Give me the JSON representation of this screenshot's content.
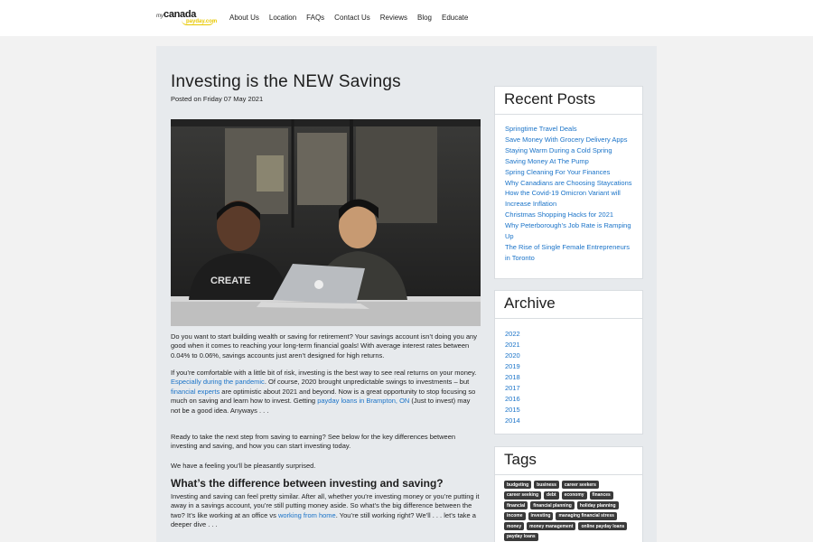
{
  "header": {
    "logo": {
      "my": "my",
      "canada": "canada",
      "payday": "payday.com"
    },
    "nav": [
      "About Us",
      "Location",
      "FAQs",
      "Contact Us",
      "Reviews",
      "Blog",
      "Educate"
    ]
  },
  "article": {
    "title": "Investing is the NEW Savings",
    "posted": "Posted on Friday 07 May 2021",
    "image_text": "CREATE",
    "p1": "Do you want to start building wealth or saving for retirement? Your savings account isn’t doing you any good when it comes to reaching your long-term financial goals! With average interest rates between 0.04% to 0.06%, savings accounts just aren’t designed for high returns.",
    "p2": {
      "t1": "If you’re comfortable with a little bit of risk, investing is the best way to see real returns on your money. ",
      "l1": "Especially during the pandemic",
      "t2": ". Of course, 2020 brought unpredictable swings to investments – but ",
      "l2": "financial experts",
      "t3": " are optimistic about 2021 and beyond. Now is a great opportunity to stop focusing so much on saving and learn how to invest. Getting ",
      "l3": "payday loans in Brampton, ON",
      "t4": " (Just to invest) may not be a good idea. Anyways . . ."
    },
    "p3": "Ready to take the next step from saving to earning? See below for the key differences between investing and saving, and how you can start investing today.",
    "p4": "We have a feeling you’ll be pleasantly surprised.",
    "subhead": "What’s the difference between investing and saving?",
    "p5": {
      "t1": "Investing and saving can feel pretty similar. After all, whether you’re investing money or you’re putting it away in a savings account, you’re still putting money aside. So what’s the big difference between the two? It’s like working at an office vs ",
      "l1": "working from home",
      "t2": ". You’re still working right? We’ll . . . let’s take a deeper dive . . ."
    }
  },
  "sidebar": {
    "recent": {
      "heading": "Recent Posts",
      "items": [
        "Springtime Travel Deals",
        "Save Money With Grocery Delivery Apps",
        "Staying Warm During a Cold Spring",
        "Saving Money At The Pump",
        "Spring Cleaning For Your Finances",
        "Why Canadians are Choosing Staycations",
        "How the Covid-19 Omicron Variant will Increase Inflation",
        "Christmas Shopping Hacks for 2021",
        "Why Peterborough’s Job Rate is Ramping Up",
        "The Rise of Single Female Entrepreneurs in Toronto"
      ]
    },
    "archive": {
      "heading": "Archive",
      "items": [
        "2022",
        "2021",
        "2020",
        "2019",
        "2018",
        "2017",
        "2016",
        "2015",
        "2014"
      ]
    },
    "tags": {
      "heading": "Tags",
      "items": [
        "budgeting",
        "business",
        "career seekers",
        "career seeking",
        "debt",
        "economy",
        "finances",
        "financial",
        "financial planning",
        "holiday planning",
        "income",
        "investing",
        "managing financial stress",
        "money",
        "money management",
        "online payday loans",
        "payday loans"
      ]
    }
  },
  "colors": {
    "link": "#1a73c8",
    "tag_bg": "#3a3a3a",
    "panel_bg": "#e7eaed",
    "logo_accent": "#e8c800"
  }
}
